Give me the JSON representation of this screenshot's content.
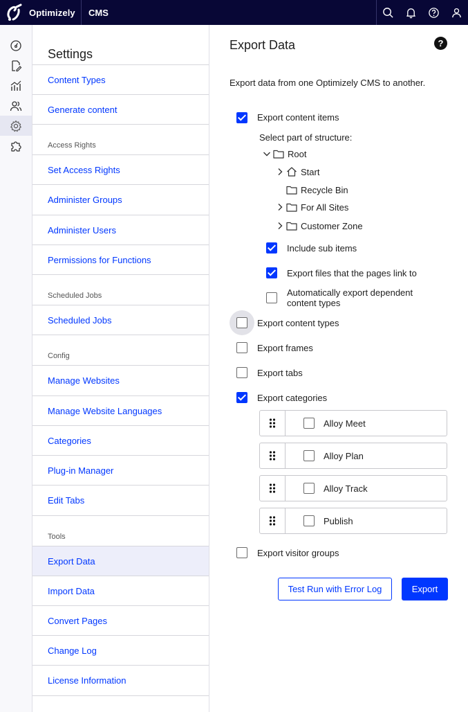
{
  "topbar": {
    "brand": "Optimizely",
    "product": "CMS",
    "icons": [
      "search-icon",
      "bell-icon",
      "help-icon",
      "user-icon"
    ]
  },
  "rail": {
    "icons": [
      "dashboard-icon",
      "edit-icon",
      "analytics-icon",
      "users-icon",
      "settings-icon",
      "addons-icon"
    ],
    "active": "settings-icon"
  },
  "nav": {
    "title": "Settings",
    "top_items": [
      "Content Types",
      "Generate content"
    ],
    "group_access": "Access Rights",
    "access_items": [
      "Set Access Rights",
      "Administer Groups",
      "Administer Users",
      "Permissions for Functions"
    ],
    "group_jobs": "Scheduled Jobs",
    "jobs_items": [
      "Scheduled Jobs"
    ],
    "group_config": "Config",
    "config_items": [
      "Manage Websites",
      "Manage Website Languages",
      "Categories",
      "Plug-in Manager",
      "Edit Tabs"
    ],
    "group_tools": "Tools",
    "tools_items": [
      "Export Data",
      "Import Data",
      "Convert Pages",
      "Change Log",
      "License Information"
    ],
    "active_item": "Export Data"
  },
  "main": {
    "title": "Export Data",
    "help": "?",
    "intro": "Export data from one Optimizely CMS to another.",
    "export_content_items": {
      "label": "Export content items",
      "checked": true
    },
    "structure_label": "Select part of structure:",
    "tree": {
      "root": "Root",
      "children": [
        "Start",
        "Recycle Bin",
        "For All Sites",
        "Customer Zone"
      ]
    },
    "include_sub_items": {
      "label": "Include sub items",
      "checked": true
    },
    "export_files": {
      "label": "Export files that the pages link to",
      "checked": true
    },
    "auto_dependent": {
      "label_line1": "Automatically export dependent",
      "label_line2": "content types",
      "checked": false
    },
    "export_content_types": {
      "label": "Export content types",
      "checked": false
    },
    "export_frames": {
      "label": "Export frames",
      "checked": false
    },
    "export_tabs": {
      "label": "Export tabs",
      "checked": false
    },
    "export_categories": {
      "label": "Export categories",
      "checked": true
    },
    "categories": [
      "Alloy Meet",
      "Alloy Plan",
      "Alloy Track",
      "Publish"
    ],
    "export_visitor_groups": {
      "label": "Export visitor groups",
      "checked": false
    },
    "test_run_label": "Test Run with Error Log",
    "export_label": "Export"
  },
  "colors": {
    "topbar": "#080736",
    "accent": "#0037ff",
    "nav_active": "#edeefa"
  }
}
